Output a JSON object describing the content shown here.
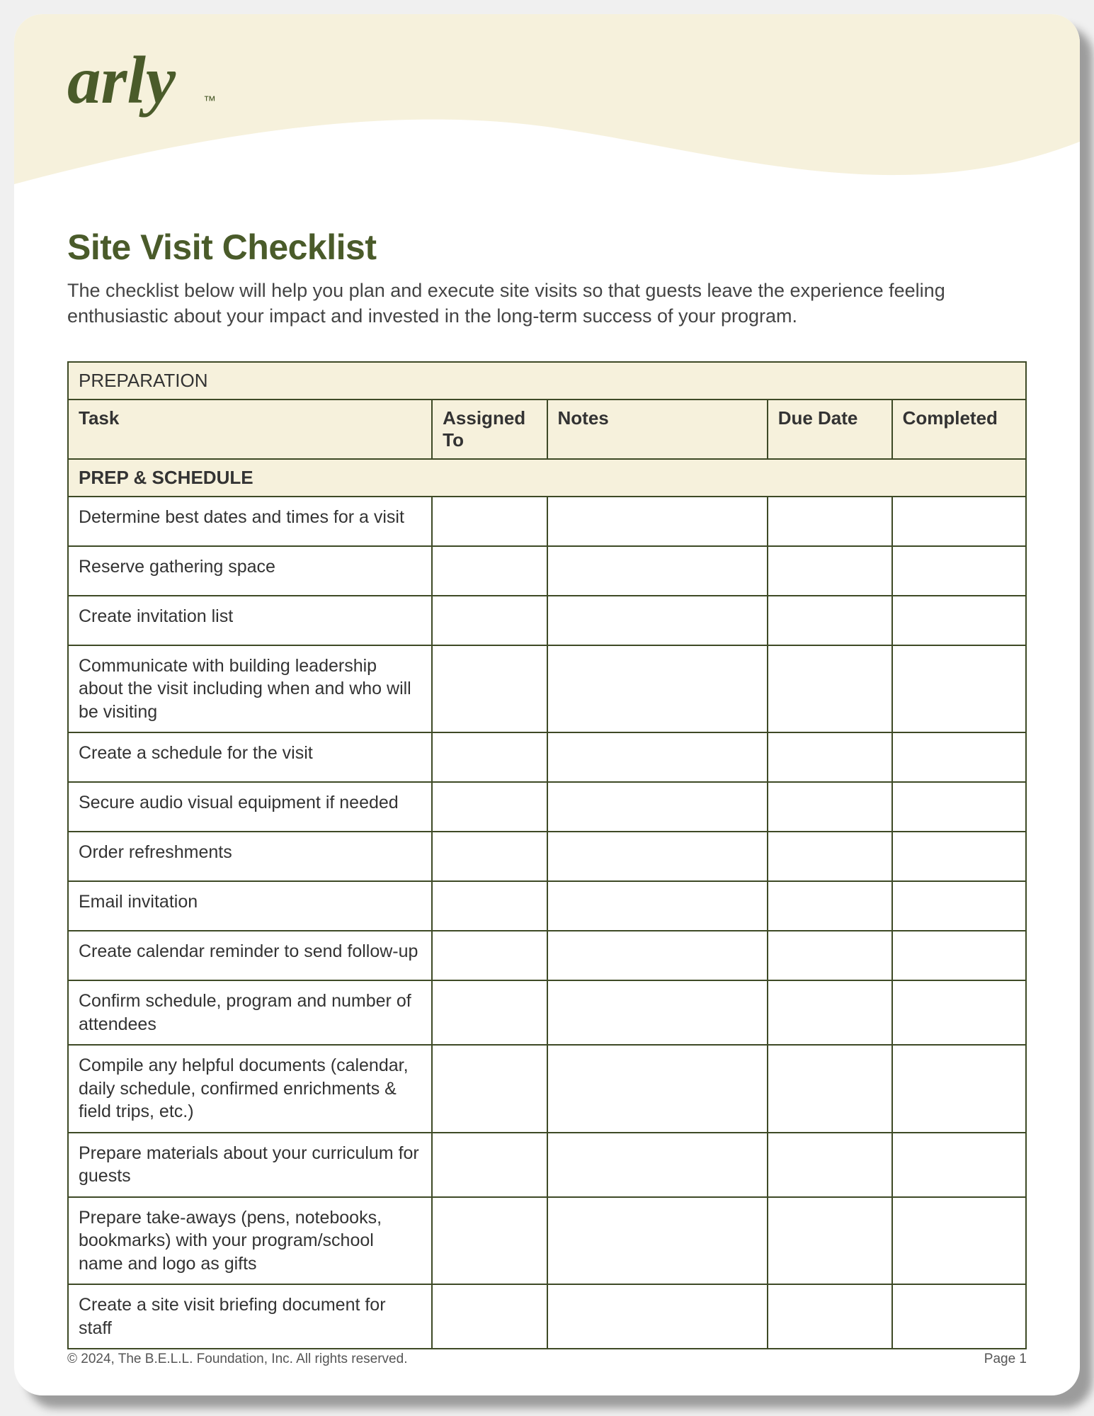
{
  "brand": {
    "logo_text": "arly",
    "logo_tm": "™"
  },
  "title": "Site Visit Checklist",
  "intro": "The checklist below will help you plan and execute site visits so that guests leave the experience feeling enthusiastic about your impact and invested in the long-term success of your program.",
  "table": {
    "section": "PREPARATION",
    "columns": {
      "task": "Task",
      "assigned": "Assigned To",
      "notes": "Notes",
      "due": "Due Date",
      "completed": "Completed"
    },
    "subsection": "PREP & SCHEDULE",
    "rows": [
      {
        "task": "Determine best dates and times for a visit",
        "assigned": "",
        "notes": "",
        "due": "",
        "completed": ""
      },
      {
        "task": "Reserve gathering space",
        "assigned": "",
        "notes": "",
        "due": "",
        "completed": ""
      },
      {
        "task": "Create invitation list",
        "assigned": "",
        "notes": "",
        "due": "",
        "completed": ""
      },
      {
        "task": "Communicate with building leadership about the visit including when and who will be visiting",
        "assigned": "",
        "notes": "",
        "due": "",
        "completed": ""
      },
      {
        "task": "Create a schedule for the visit",
        "assigned": "",
        "notes": "",
        "due": "",
        "completed": ""
      },
      {
        "task": "Secure audio visual equipment if needed",
        "assigned": "",
        "notes": "",
        "due": "",
        "completed": ""
      },
      {
        "task": "Order refreshments",
        "assigned": "",
        "notes": "",
        "due": "",
        "completed": ""
      },
      {
        "task": "Email invitation",
        "assigned": "",
        "notes": "",
        "due": "",
        "completed": ""
      },
      {
        "task": "Create calendar reminder to send follow-up",
        "assigned": "",
        "notes": "",
        "due": "",
        "completed": ""
      },
      {
        "task": "Confirm schedule, program and number of attendees",
        "assigned": "",
        "notes": "",
        "due": "",
        "completed": ""
      },
      {
        "task": "Compile any helpful documents (calendar, daily schedule, confirmed enrichments & field trips, etc.)",
        "assigned": "",
        "notes": "",
        "due": "",
        "completed": ""
      },
      {
        "task": "Prepare materials about your curriculum for guests",
        "assigned": "",
        "notes": "",
        "due": "",
        "completed": ""
      },
      {
        "task": "Prepare take-aways (pens, notebooks, bookmarks) with your program/school name and logo as gifts",
        "assigned": "",
        "notes": "",
        "due": "",
        "completed": ""
      },
      {
        "task": "Create a site visit briefing document for staff",
        "assigned": "",
        "notes": "",
        "due": "",
        "completed": ""
      }
    ]
  },
  "footer": {
    "copyright": "© 2024, The B.E.L.L. Foundation, Inc. All rights reserved.",
    "page": "Page 1"
  }
}
